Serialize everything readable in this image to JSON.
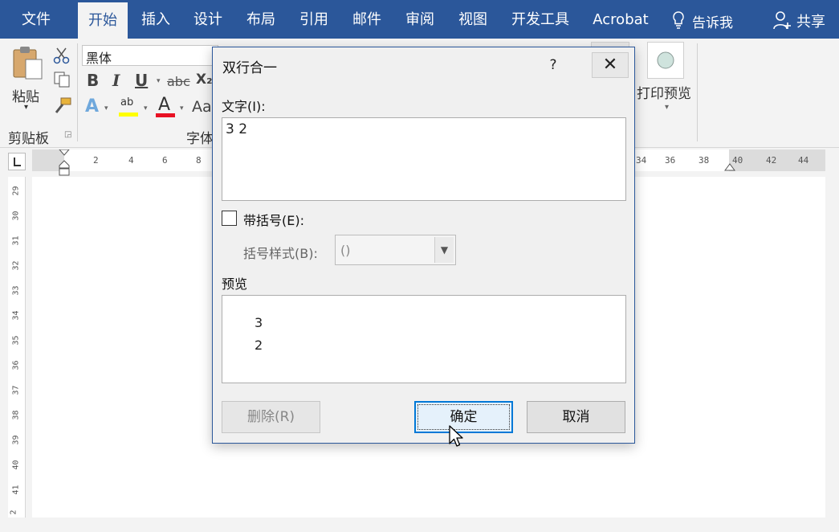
{
  "menubar": {
    "tabs": [
      "文件",
      "开始",
      "插入",
      "设计",
      "布局",
      "引用",
      "邮件",
      "审阅",
      "视图",
      "开发工具",
      "Acrobat"
    ],
    "active": "开始",
    "tell_me": "告诉我",
    "share": "共享"
  },
  "ribbon": {
    "paste_label": "粘贴",
    "clipboard_group": "剪贴板",
    "font_name": "黑体",
    "font_group": "字体",
    "print_preview": "打印预览",
    "bold": "B",
    "italic": "I",
    "underline": "U",
    "strike": "abc",
    "subscript": "X₂",
    "font_color_letter": "A",
    "case_letters": "Aa",
    "highlight_letters": "ab"
  },
  "ruler": {
    "left_numbers": [
      "2",
      "4",
      "6",
      "8"
    ],
    "right_numbers": [
      "34",
      "36",
      "38",
      "40",
      "42",
      "44"
    ],
    "vertical_numbers": [
      "29",
      "30",
      "31",
      "32",
      "33",
      "34",
      "35",
      "36",
      "37",
      "38",
      "39",
      "40",
      "41",
      "2"
    ]
  },
  "dialog": {
    "title": "双行合一",
    "help": "?",
    "close": "✕",
    "text_label": "文字(I):",
    "text_value": "3 2",
    "bracket_label": "带括号(E):",
    "bracket_style_label": "括号样式(B):",
    "bracket_style_value": "()",
    "preview_label": "预览",
    "preview_line1": "3",
    "preview_line2": "2",
    "delete_button": "删除(R)",
    "ok_button": "确定",
    "cancel_button": "取消"
  },
  "colors": {
    "accent": "#2b579a",
    "highlight_yellow": "#ffff00",
    "font_red": "#e81123",
    "focus_blue": "#0078d7"
  },
  "icons": [
    "scissors-icon",
    "copy-icon",
    "format-painter-icon",
    "lightbulb-icon",
    "user-icon",
    "dropdown-arrow-icon",
    "mouse-pointer-icon"
  ]
}
